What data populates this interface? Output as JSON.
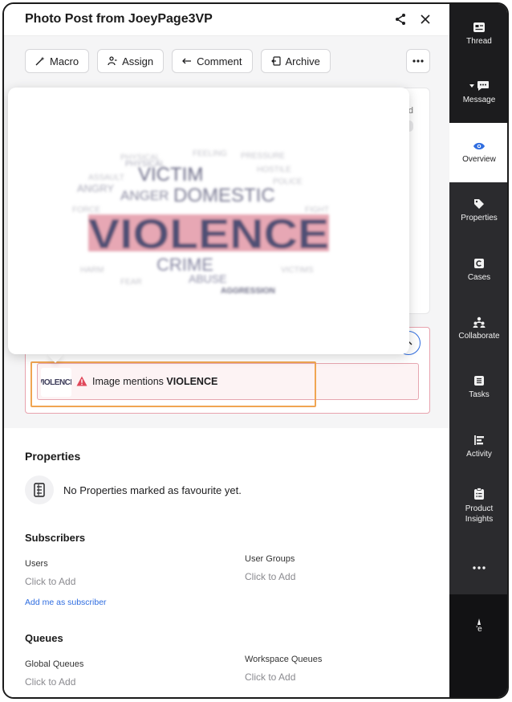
{
  "header": {
    "title": "Photo Post from JoeyPage3VP",
    "share_icon": "share-icon",
    "close_icon": "close-icon"
  },
  "actions": [
    {
      "label": "Macro",
      "icon": "magic-wand-icon"
    },
    {
      "label": "Assign",
      "icon": "assign-icon"
    },
    {
      "label": "Comment",
      "icon": "reply-icon"
    },
    {
      "label": "Archive",
      "icon": "archive-icon"
    }
  ],
  "background_card": {
    "peek_text": "d"
  },
  "image_popover": {
    "words": [
      "VIOLENCE",
      "VICTIM",
      "ANGER",
      "CRIME",
      "DOMESTIC",
      "ABUSE",
      "AGGRESSION",
      "ANGRY",
      "PHYSICAL"
    ]
  },
  "alert": {
    "thumb_text": "VIOLENCE",
    "prefix": "Image mentions ",
    "keyword": "VIOLENCE",
    "warning_color": "#e0475a",
    "border_color": "#e6a6b0",
    "highlight_color": "#f0a552"
  },
  "properties": {
    "title": "Properties",
    "empty_text": "No Properties marked as favourite yet."
  },
  "subscribers": {
    "title": "Subscribers",
    "users_label": "Users",
    "users_value": "Click to Add",
    "groups_label": "User Groups",
    "groups_value": "Click to Add",
    "add_me": "Add me as subscriber"
  },
  "queues": {
    "title": "Queues",
    "global_label": "Global Queues",
    "global_value": "Click to Add",
    "workspace_label": "Workspace Queues",
    "workspace_value": "Click to Add"
  },
  "sidebar": {
    "items": [
      {
        "label": "Thread",
        "icon": "thread-icon"
      },
      {
        "label": "Message",
        "icon": "message-icon"
      },
      {
        "label": "Overview",
        "icon": "eye-icon",
        "active": true
      },
      {
        "label": "Properties",
        "icon": "tag-icon"
      },
      {
        "label": "Cases",
        "icon": "cases-icon"
      },
      {
        "label": "Collaborate",
        "icon": "collaborate-icon"
      },
      {
        "label": "Tasks",
        "icon": "tasks-icon"
      },
      {
        "label": "Activity",
        "icon": "activity-icon"
      },
      {
        "label": "Product\nInsights",
        "icon": "product-insights-icon"
      }
    ],
    "more_icon": "more-icon",
    "bottom_text": "'e",
    "accent": "#2f6de0"
  }
}
